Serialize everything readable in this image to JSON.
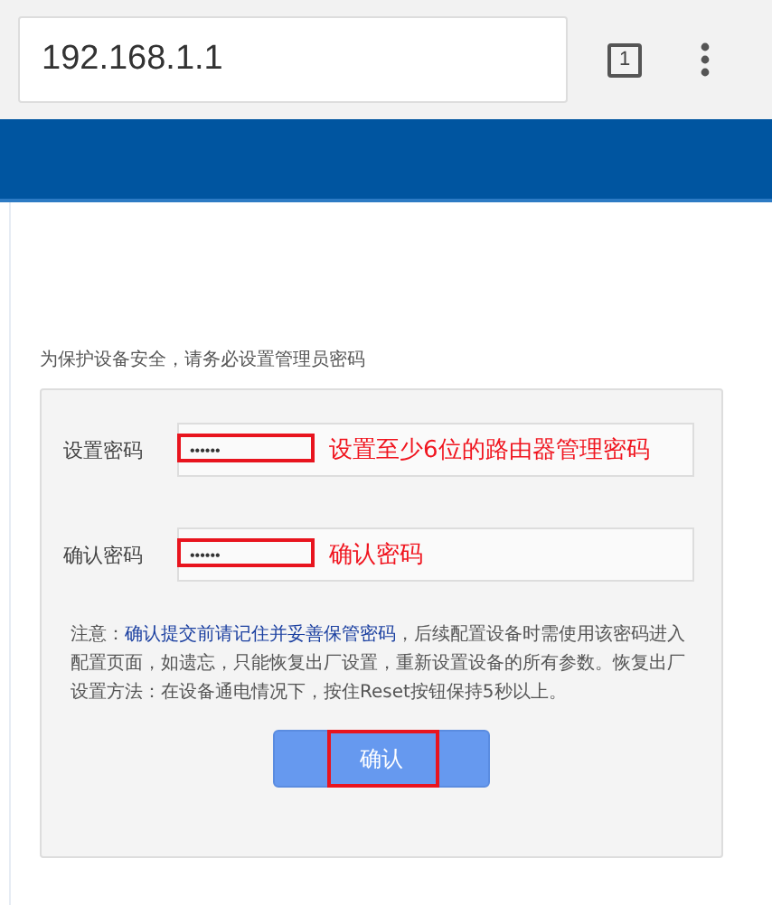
{
  "browser": {
    "url": "192.168.1.1",
    "tab_count": "1"
  },
  "page": {
    "intro": "为保护设备安全，请务必设置管理员密码",
    "fields": [
      {
        "label": "设置密码",
        "value": "••••••",
        "annotation": "设置至少6位的路由器管理密码"
      },
      {
        "label": "确认密码",
        "value": "••••••",
        "annotation": "确认密码"
      }
    ],
    "note": {
      "prefix": "注意：",
      "highlight": "确认提交前请记住并妥善保管密码",
      "rest": "，后续配置设备时需使用该密码进入配置页面，如遗忘，只能恢复出厂设置，重新设置设备的所有参数。恢复出厂设置方法：在设备通电情况下，按住Reset按钮保持5秒以上。"
    },
    "button": "确认"
  }
}
